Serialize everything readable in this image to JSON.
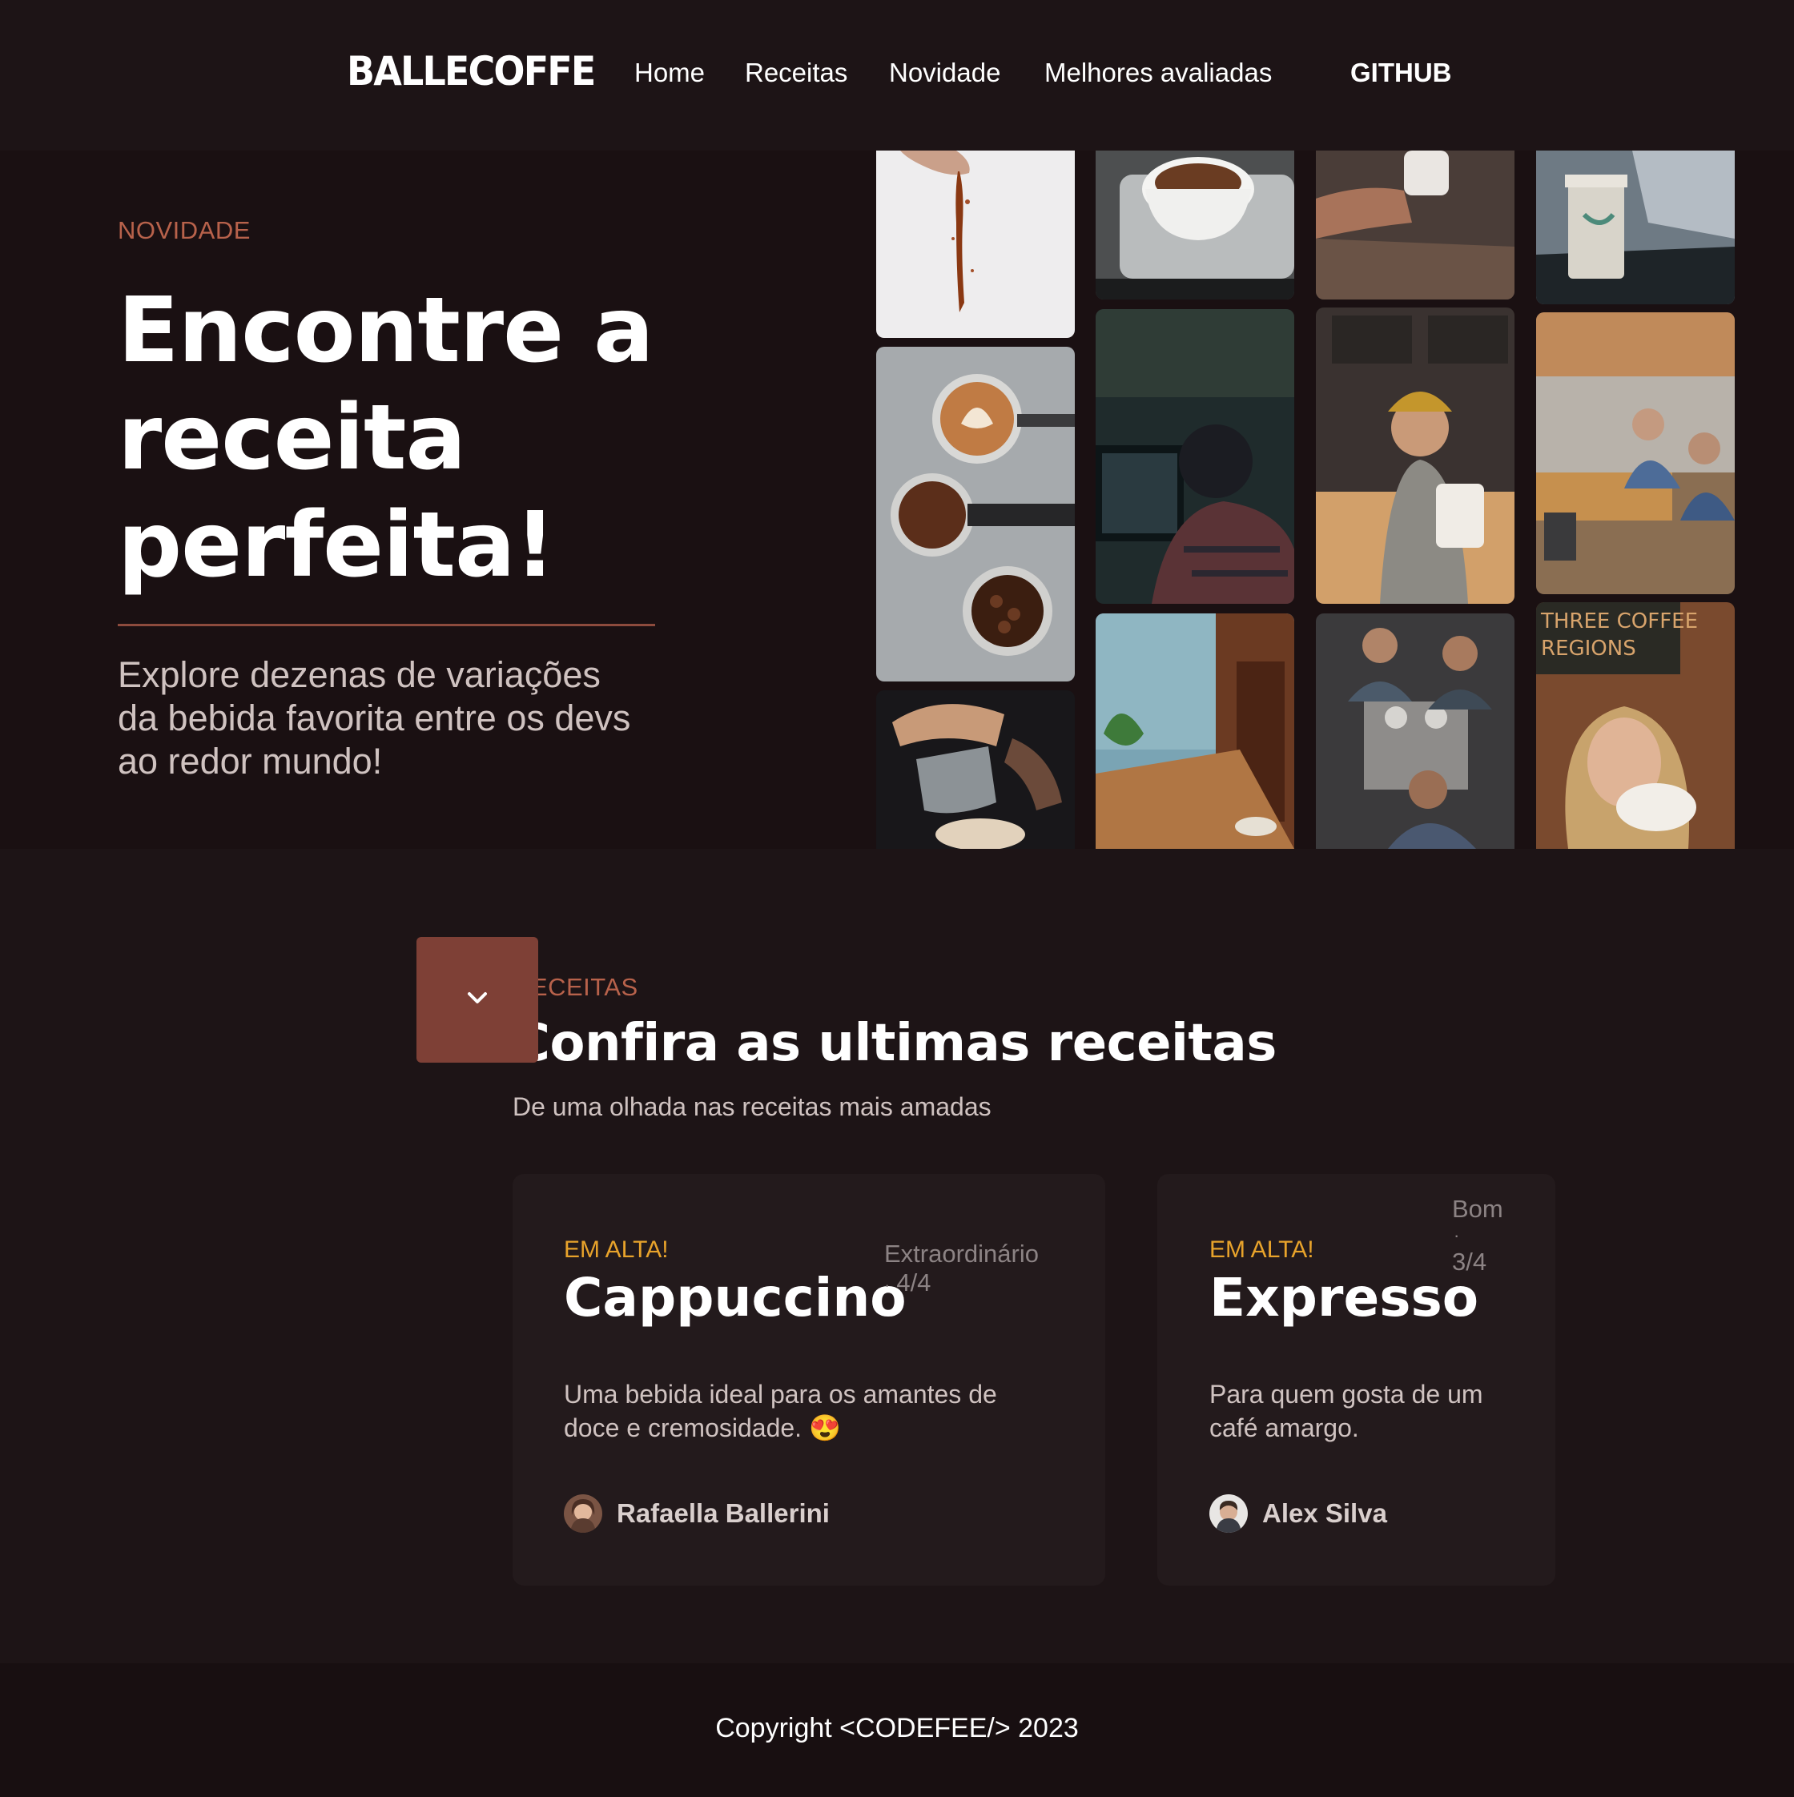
{
  "nav": {
    "brand": "BALLECOFFE",
    "links": [
      "Home",
      "Receitas",
      "Novidade",
      "Melhores avaliadas"
    ],
    "github": "GITHUB"
  },
  "hero": {
    "eyebrow": "NOVIDADE",
    "title": "Encontre a receita perfeita!",
    "subtitle": "Explore dezenas de variações da bebida favorita entre os devs ao redor mundo!",
    "scroll_icon": "chevron-down-icon",
    "accent": "#7e4036"
  },
  "gallery": [
    "coffee-pour-photo",
    "latte-art-portafilter-photo",
    "milk-pitcher-latte-art-photo",
    "coffee-cup-tray-photo",
    "developer-at-computer-photo",
    "cafe-window-seat-photo",
    "hand-holding-cup-photo",
    "barista-coffee-machine-photo",
    "baristas-espresso-machine-photo",
    "takeaway-cup-laptop-photo",
    "coworking-office-photo",
    "woman-drinking-coffee-photo"
  ],
  "recipes": {
    "eyebrow": "RECEITAS",
    "title": "Confira as ultimas receitas",
    "subtitle": "De uma olhada nas receitas mais amadas",
    "cards": [
      {
        "tag": "EM ALTA!",
        "title": "Cappuccino",
        "rating_label": "Extraordinário",
        "rating_sep": "·",
        "rating_score": "4/4",
        "description": "Uma bebida ideal para os amantes de doce e cremosidade. 😍",
        "author": "Rafaella Ballerini"
      },
      {
        "tag": "EM ALTA!",
        "title": "Expresso",
        "rating_label": "Bom",
        "rating_sep": "·",
        "rating_score": "3/4",
        "description": "Para quem gosta de um café amargo.",
        "author": "Alex Silva"
      }
    ]
  },
  "footer": {
    "copyright": "Copyright <CODEFEE/> 2023"
  },
  "colors": {
    "background": "#1d1416",
    "hero_background": "#1a1012",
    "eyebrow": "#b8624b",
    "tag": "#e8a32b",
    "card": "#231a1c"
  }
}
